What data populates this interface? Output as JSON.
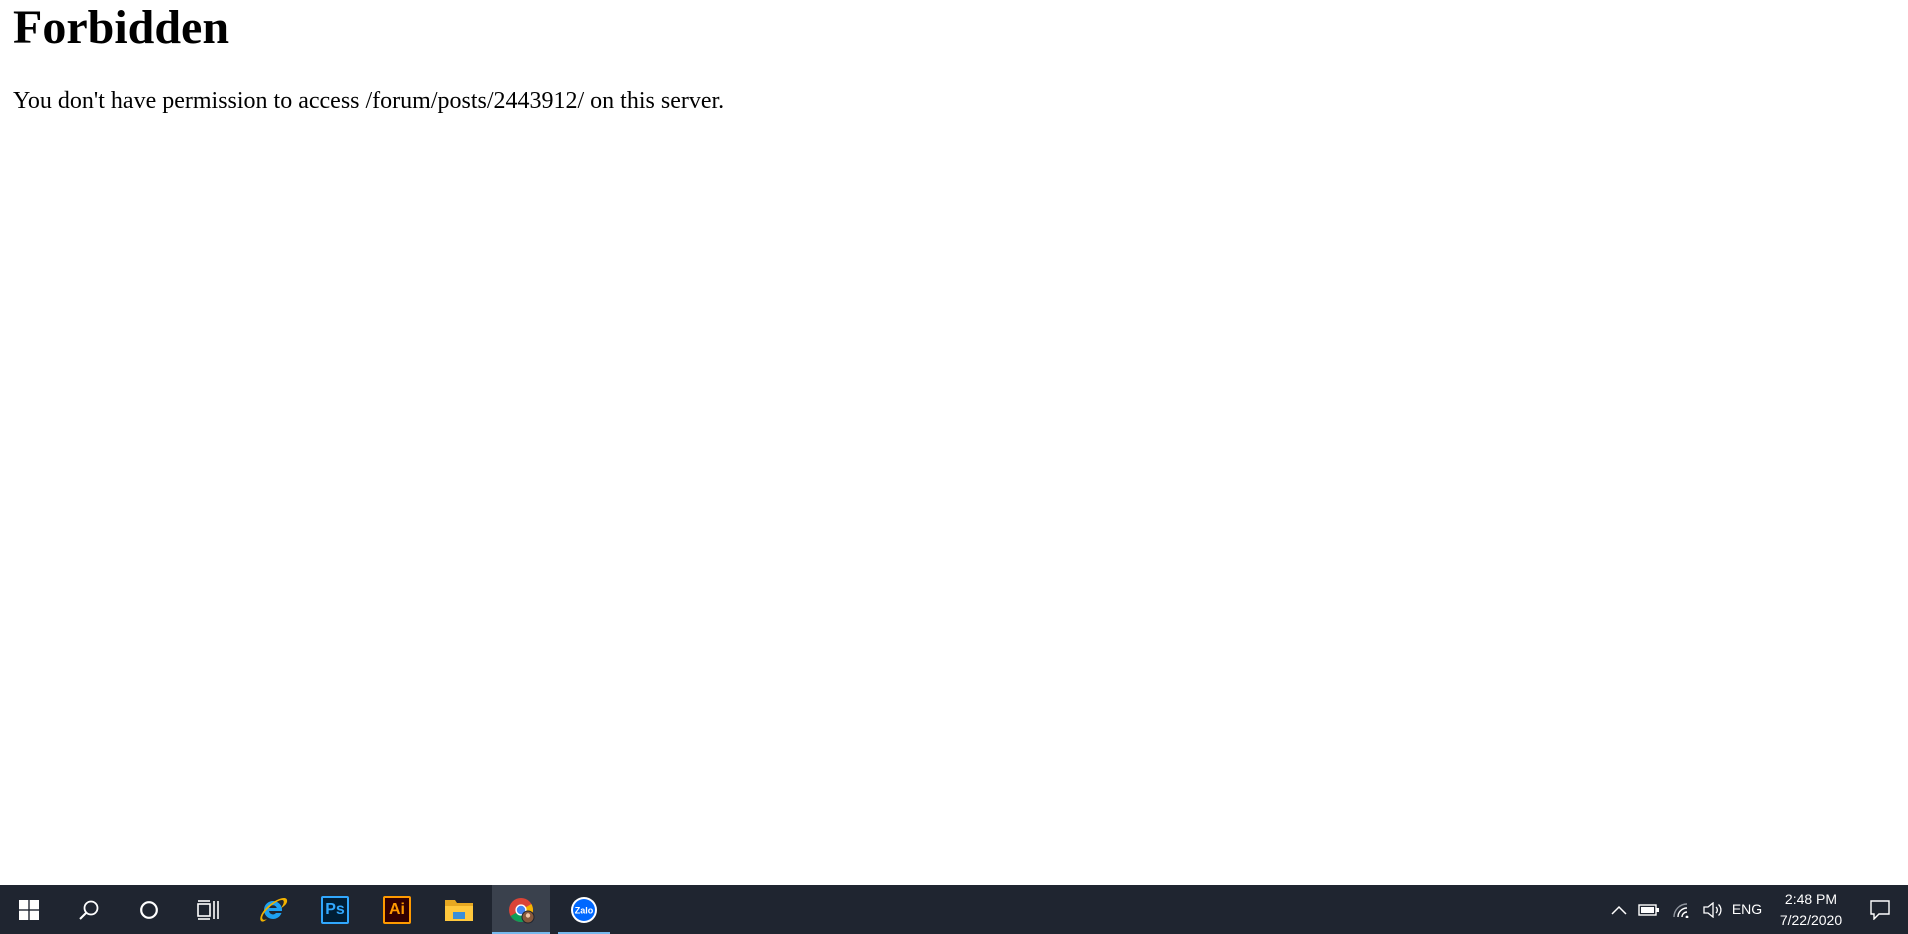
{
  "page": {
    "heading": "Forbidden",
    "message": "You don't have permission to access /forum/posts/2443912/ on this server."
  },
  "taskbar": {
    "background": "#1f2530",
    "accent": "#76b9ed",
    "apps": [
      {
        "name": "internet-explorer",
        "icon": "ie-icon"
      },
      {
        "name": "photoshop",
        "icon": "photoshop-icon",
        "label": "Ps"
      },
      {
        "name": "illustrator",
        "icon": "illustrator-icon",
        "label": "Ai"
      },
      {
        "name": "file-explorer",
        "icon": "folder-icon"
      },
      {
        "name": "chrome",
        "icon": "chrome-icon",
        "active": true
      },
      {
        "name": "zalo",
        "icon": "zalo-icon",
        "label": "Zalo",
        "running": true
      }
    ],
    "tray": {
      "language": "ENG",
      "time": "2:48 PM",
      "date": "7/22/2020"
    }
  }
}
